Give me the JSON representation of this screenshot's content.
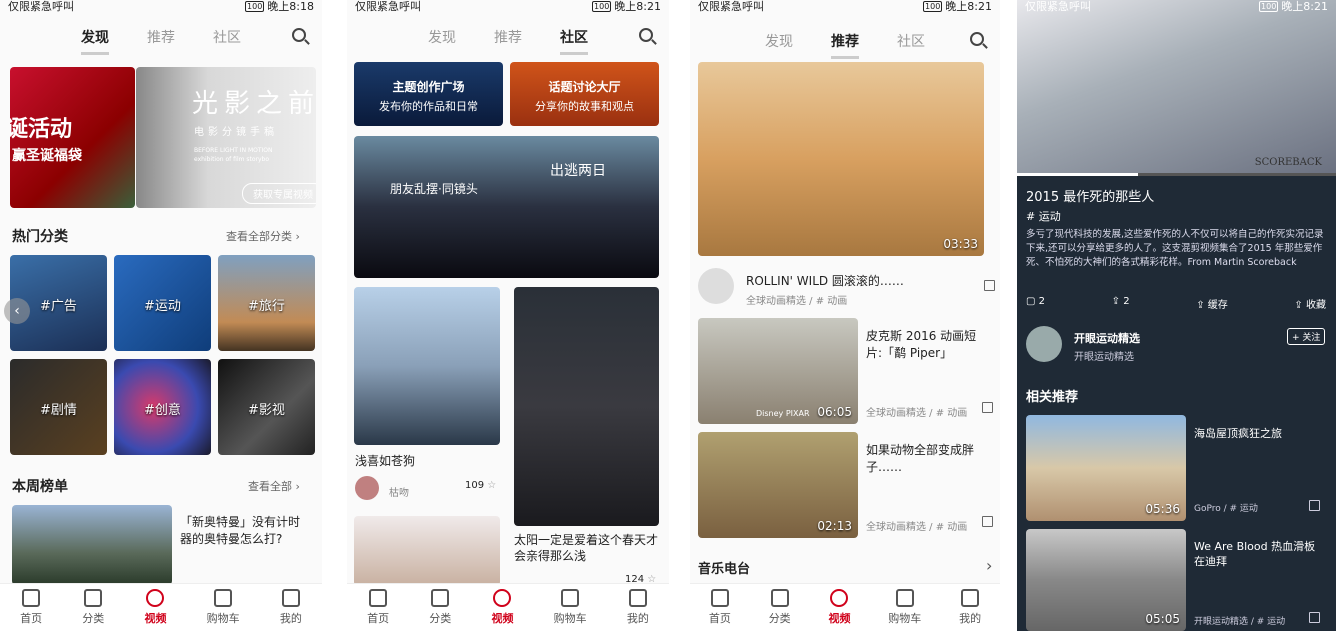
{
  "status": {
    "left": "仅限紧急呼叫",
    "right1": "晚上8:18",
    "right2": "晚上8:21",
    "right3": "晚上8:21",
    "right4": "晚上8:21",
    "battery": "100"
  },
  "tabs": {
    "discover": "发现",
    "recommend": "推荐",
    "community": "社区"
  },
  "nav": {
    "home": "首页",
    "category": "分类",
    "video": "视频",
    "cart": "购物车",
    "mine": "我的"
  },
  "p1": {
    "banner_left": "诞活动",
    "banner_left_sub": "赢圣诞福袋",
    "banner_right": "光影之前",
    "banner_right_sub": "电影分镜手稿",
    "banner_right_en1": "BEFORE LIGHT IN MOTION",
    "banner_right_en2": "exhibition of film storybo",
    "banner_btn": "获取专属视频",
    "hot_title": "热门分类",
    "hot_more": "查看全部分类",
    "cats": [
      "#广告",
      "#运动",
      "#旅行",
      "#剧情",
      "#创意",
      "#影视"
    ],
    "week_title": "本周榜单",
    "week_more": "查看全部",
    "week_item": "「新奥特曼」没有计时器的奥特曼怎么打?"
  },
  "p2": {
    "card1_title": "主题创作广场",
    "card1_sub": "发布你的作品和日常",
    "card2_title": "话题讨论大厅",
    "card2_sub": "分享你的故事和观点",
    "big_text1": "朋友乱摆·同镜头",
    "big_text2": "出逃两日",
    "post1_title": "浅喜如苍狗",
    "post1_user": "枯吻",
    "post1_likes": "109",
    "post2_title": "太阳一定是爱着这个春天才会亲得那么浅",
    "post2_likes": "124"
  },
  "p3": {
    "v1_dur": "03:33",
    "v1_title": "ROLLIN' WILD 圆滚滚的……",
    "v1_meta": "全球动画精选 / # 动画",
    "v2_dur": "06:05",
    "v2_title": "皮克斯 2016 动画短片:「鹬 Piper」",
    "v2_meta": "全球动画精选 / # 动画",
    "v2_brand": "Disney PIXAR",
    "v3_dur": "02:13",
    "v3_title": "如果动物全部变成胖子……",
    "v3_meta": "全球动画精选 / # 动画",
    "radio": "音乐电台"
  },
  "p4": {
    "title": "2015 最作死的那些人",
    "tag": "# 运动",
    "desc": "多亏了现代科技的发展,这些爱作死的人不仅可以将自己的作死实况记录下来,还可以分享给更多的人了。这支混剪视频集合了2015 年那些爱作死、不怕死的大神们的各式精彩花样。From Martin Scoreback",
    "watermark": "SCOREBACK",
    "comments": "2",
    "shares": "2",
    "cache": "缓存",
    "fav": "收藏",
    "author": "开眼运动精选",
    "author_sub": "开眼运动精选",
    "follow": "+ 关注",
    "related": "相关推荐",
    "r1_title": "海岛屋顶疯狂之旅",
    "r1_dur": "05:36",
    "r1_meta": "GoPro / # 运动",
    "r2_title": "We Are Blood 热血滑板在迪拜",
    "r2_dur": "05:05",
    "r2_meta": "开眼运动精选 / # 运动"
  }
}
